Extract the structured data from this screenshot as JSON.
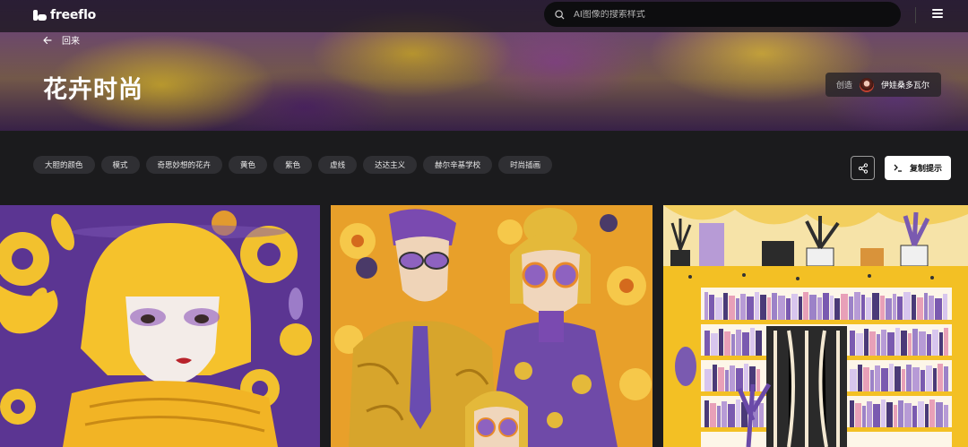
{
  "nav": {
    "logo_text": "freeflo",
    "search_placeholder": "AI图像的搜索样式"
  },
  "hero": {
    "back_label": "回来",
    "title": "花卉时尚",
    "creator_label": "创造",
    "creator_name": "伊娃桑多瓦尔"
  },
  "tags": [
    {
      "label": "大胆的颜色"
    },
    {
      "label": "模式"
    },
    {
      "label": "奇思妙想的花卉"
    },
    {
      "label": "黄色"
    },
    {
      "label": "紫色"
    },
    {
      "label": "虚线"
    },
    {
      "label": "达达主义"
    },
    {
      "label": "赫尔辛基学校"
    },
    {
      "label": "时尚插画"
    }
  ],
  "actions": {
    "copy_prompt_label": "复制提示"
  },
  "colors": {
    "yellow": "#f2c12e",
    "purple": "#6e3fa0",
    "band_bg": "#1b1b1d",
    "tag_bg": "#2f2f33"
  },
  "gallery": {
    "cards": [
      {
        "alt": "woman-with-yellow-bob-and-purple-florals"
      },
      {
        "alt": "couple-in-patterned-suits-with-purple-sunglasses"
      },
      {
        "alt": "yellow-bookshelf-with-plants"
      }
    ]
  }
}
